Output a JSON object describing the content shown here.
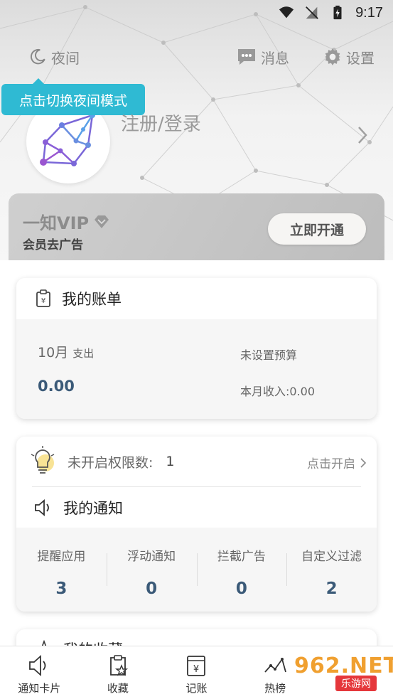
{
  "status_bar": {
    "time": "9:17"
  },
  "header": {
    "night_label": "夜间",
    "message_label": "消息",
    "settings_label": "设置",
    "tooltip": "点击切换夜间模式",
    "login_text": "注册/登录"
  },
  "vip": {
    "title": "一知VIP",
    "subtitle": "会员去广告",
    "button": "立即开通"
  },
  "bill": {
    "title": "我的账单",
    "month": "10月",
    "month_suffix": "支出",
    "amount": "0.00",
    "budget": "未设置预算",
    "income": "本月收入:0.00"
  },
  "notice": {
    "perm_label": "未开启权限数:",
    "perm_count": "1",
    "perm_action": "点击开启",
    "title": "我的通知",
    "stats": [
      {
        "label": "提醒应用",
        "value": "3"
      },
      {
        "label": "浮动通知",
        "value": "0"
      },
      {
        "label": "拦截广告",
        "value": "0"
      },
      {
        "label": "自定义过滤",
        "value": "2"
      }
    ]
  },
  "favorites": {
    "title": "我的收藏"
  },
  "bottom_nav": [
    {
      "label": "通知卡片",
      "icon": "speaker-icon"
    },
    {
      "label": "收藏",
      "icon": "clipboard-star-icon"
    },
    {
      "label": "记账",
      "icon": "ledger-icon"
    },
    {
      "label": "热榜",
      "icon": "trend-icon"
    }
  ],
  "watermark": {
    "logo": "962.NET",
    "sub": "乐游网"
  },
  "colors": {
    "accent": "#2fbad3",
    "value_blue": "#3b5a78",
    "watermark_orange": "#f0a030",
    "watermark_red": "#e5373b"
  }
}
